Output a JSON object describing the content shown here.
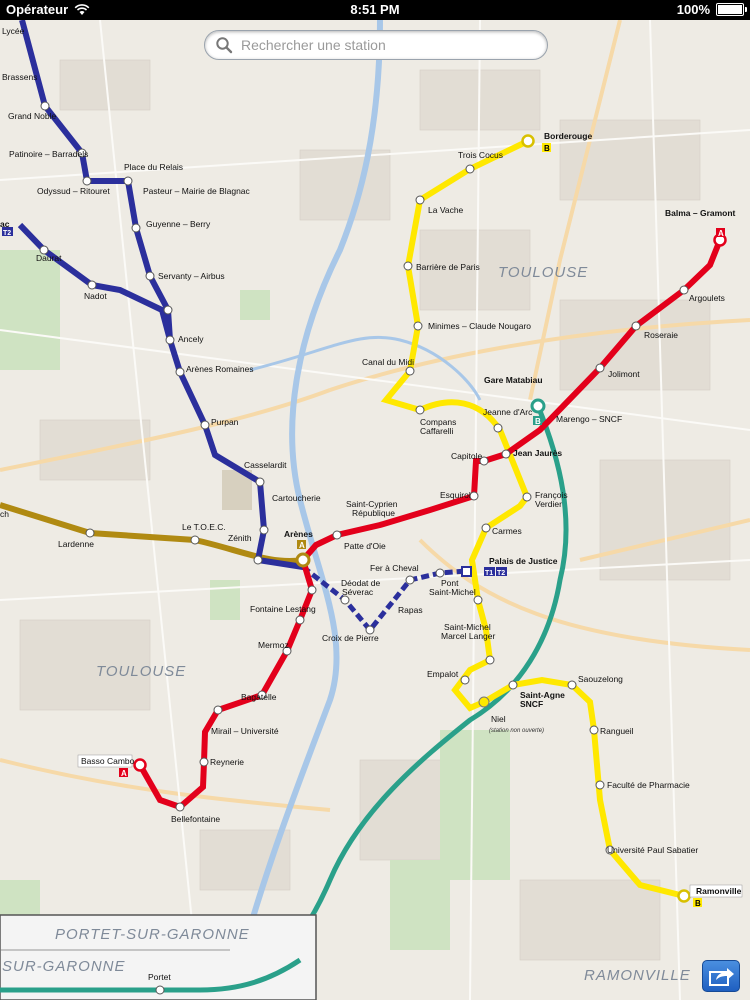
{
  "status_bar": {
    "carrier": "Opérateur",
    "time": "8:51 PM",
    "battery": "100%"
  },
  "search": {
    "placeholder": "Rechercher une station"
  },
  "map_labels": {
    "toulouse_east": "TOULOUSE",
    "toulouse_west": "TOULOUSE",
    "portet": "PORTET-SUR-GARONNE",
    "sur_garonne": "SUR-GARONNE",
    "ramonville": "RAMONVILLE"
  },
  "line_badges": {
    "a": "A",
    "b": "B",
    "t1": "T1",
    "t2": "T2"
  },
  "colors": {
    "line_a": "#e3001b",
    "line_b": "#ffe800",
    "tram": "#2b2f9c",
    "garonne": "#b08a12",
    "teal": "#2aa08a"
  },
  "stations": {
    "lycee": "Lycée",
    "brassens": "Brassens",
    "grand_noble": "Grand Noble",
    "patinoire": "Patinoire – Barradels",
    "odyssud": "Odyssud – Ritouret",
    "place_relais": "Place du Relais",
    "pasteur": "Pasteur – Mairie de Blagnac",
    "guyenne": "Guyenne – Berry",
    "daurat": "Daurat",
    "nadot": "Nadot",
    "servanty": "Servanty – Airbus",
    "ac": "ac",
    "ancely": "Ancely",
    "arenes_romaines": "Arènes Romaines",
    "purpan": "Purpan",
    "casselardit": "Casselardit",
    "cartoucherie": "Cartoucherie",
    "zenith": "Zénith",
    "toec": "Le T.O.E.C.",
    "lardenne": "Lardenne",
    "ch": "ch",
    "arenes": "Arènes",
    "patte_oie": "Patte d'Oie",
    "saint_cyprien_1": "Saint-Cyprien",
    "saint_cyprien_2": "République",
    "esquirol": "Esquirol",
    "capitole": "Capitole",
    "jean_jaures": "Jean Jaurès",
    "marengo": "Marengo – SNCF",
    "gare_matabiau": "Gare Matabiau",
    "jolimont": "Jolimont",
    "roseraie": "Roseraie",
    "argoulets": "Argoulets",
    "balma": "Balma – Gramont",
    "borderouge": "Borderouge",
    "trois_cocus": "Trois Cocus",
    "la_vache": "La Vache",
    "barriere_paris": "Barrière de Paris",
    "minimes": "Minimes – Claude Nougaro",
    "canal_midi": "Canal du Midi",
    "compans_1": "Compans",
    "compans_2": "Caffarelli",
    "jeanne_arc": "Jeanne d'Arc",
    "francois_1": "François",
    "francois_2": "Verdier",
    "carmes": "Carmes",
    "palais_justice": "Palais de Justice",
    "fer_cheval": "Fer à Cheval",
    "pont_1": "Pont",
    "pont_2": "Saint-Michel",
    "deodat_1": "Déodat de",
    "deodat_2": "Séverac",
    "rapas": "Rapas",
    "croix_pierre": "Croix de Pierre",
    "fontaine_lestang": "Fontaine Lestang",
    "mermoz": "Mermoz",
    "bagatelle": "Bagatelle",
    "mirail": "Mirail – Université",
    "reynerie": "Reynerie",
    "bellefontaine": "Bellefontaine",
    "basso_cambo": "Basso Cambo",
    "saint_michel_1": "Saint-Michel",
    "saint_michel_2": "Marcel Langer",
    "empalot": "Empalot",
    "saint_agne_1": "Saint-Agne",
    "saint_agne_2": "SNCF",
    "niel": "Niel",
    "niel_note": "(station non ouverte)",
    "saouzelong": "Saouzelong",
    "rangueil": "Rangueil",
    "faculte": "Faculté de Pharmacie",
    "universite": "Université Paul Sabatier",
    "ramonville": "Ramonville",
    "portet": "Portet"
  }
}
